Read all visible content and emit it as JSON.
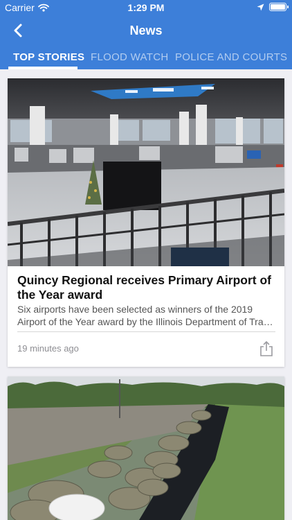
{
  "status_bar": {
    "carrier": "Carrier",
    "time": "1:29 PM"
  },
  "nav": {
    "title": "News",
    "back_icon": "chevron-left-icon"
  },
  "tabs": [
    {
      "label": "TOP STORIES",
      "active": true
    },
    {
      "label": "FLOOD WATCH",
      "active": false
    },
    {
      "label": "POLICE AND COURTS",
      "active": false
    }
  ],
  "stories": [
    {
      "image": "airport-terminal-photo",
      "headline_lines": [
        "Quincy Regional receives Primary Airport of",
        "the Year award"
      ],
      "summary_lines": [
        "Six airports have been selected as winners of the 2019",
        "Airport of the Year award by the Illinois Department of Transportation"
      ],
      "time_ago": "19 minutes ago",
      "share_icon": "share-icon"
    },
    {
      "image": "flood-sandbag-levee-photo"
    }
  ],
  "colors": {
    "header_blue": "#3d7fd9",
    "background": "#efeff4"
  }
}
